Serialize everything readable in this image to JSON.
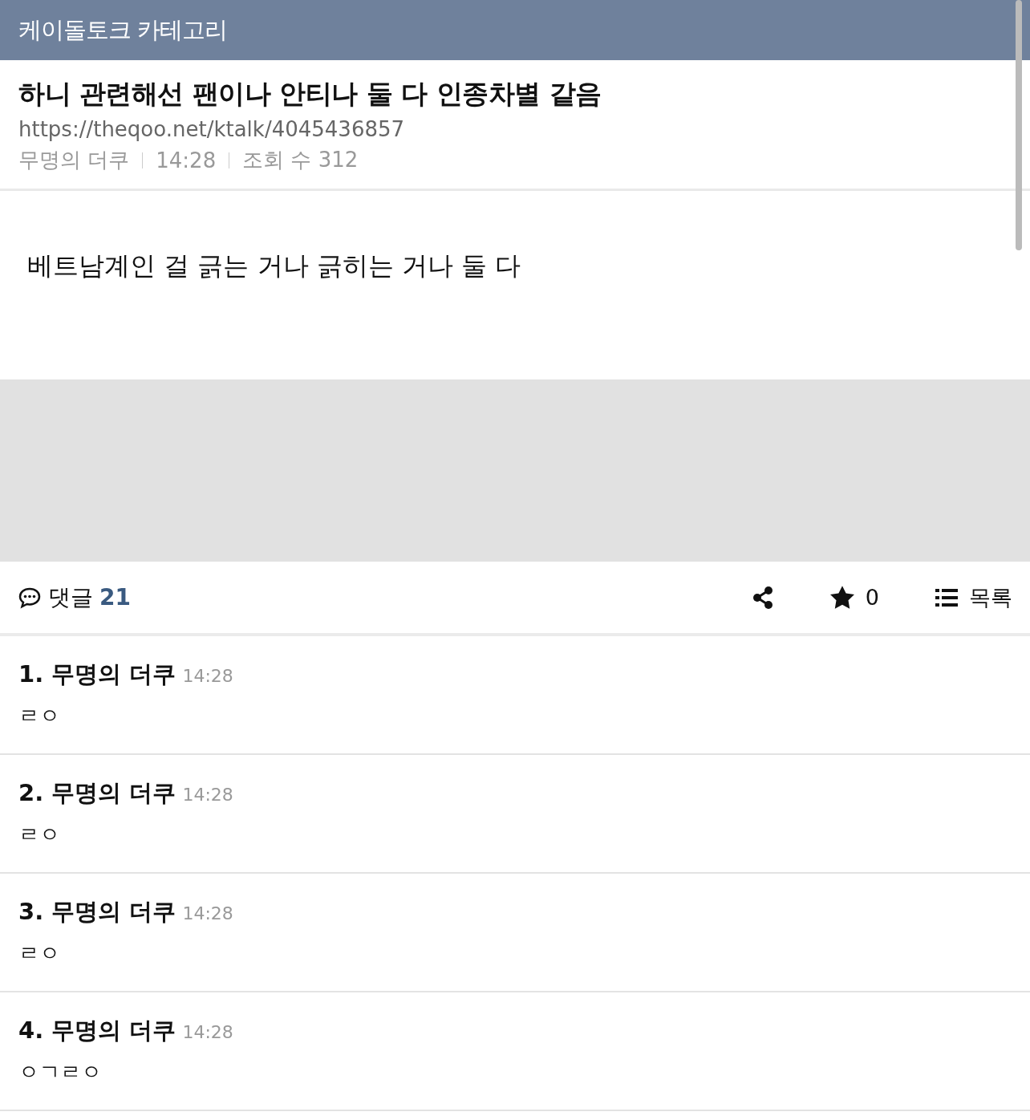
{
  "header": {
    "title": "케이돌토크 카테고리"
  },
  "post": {
    "title": "하니 관련해선 팬이나 안티나 둘 다 인종차별 같음",
    "url": "https://theqoo.net/ktalk/4045436857",
    "author": "무명의 더쿠",
    "time": "14:28",
    "views": "조회 수 312",
    "body": "베트남계인 걸 긁는 거나 긁히는 거나 둘 다"
  },
  "toolbar": {
    "comments_label": "댓글",
    "comments_count": "21",
    "stars": "0",
    "list_label": "목록"
  },
  "comments": [
    {
      "index": "1.",
      "author": "무명의 더쿠",
      "time": "14:28",
      "text": "ㄹㅇ"
    },
    {
      "index": "2.",
      "author": "무명의 더쿠",
      "time": "14:28",
      "text": "ㄹㅇ"
    },
    {
      "index": "3.",
      "author": "무명의 더쿠",
      "time": "14:28",
      "text": "ㄹㅇ"
    },
    {
      "index": "4.",
      "author": "무명의 더쿠",
      "time": "14:28",
      "text": "ㅇㄱㄹㅇ"
    }
  ]
}
